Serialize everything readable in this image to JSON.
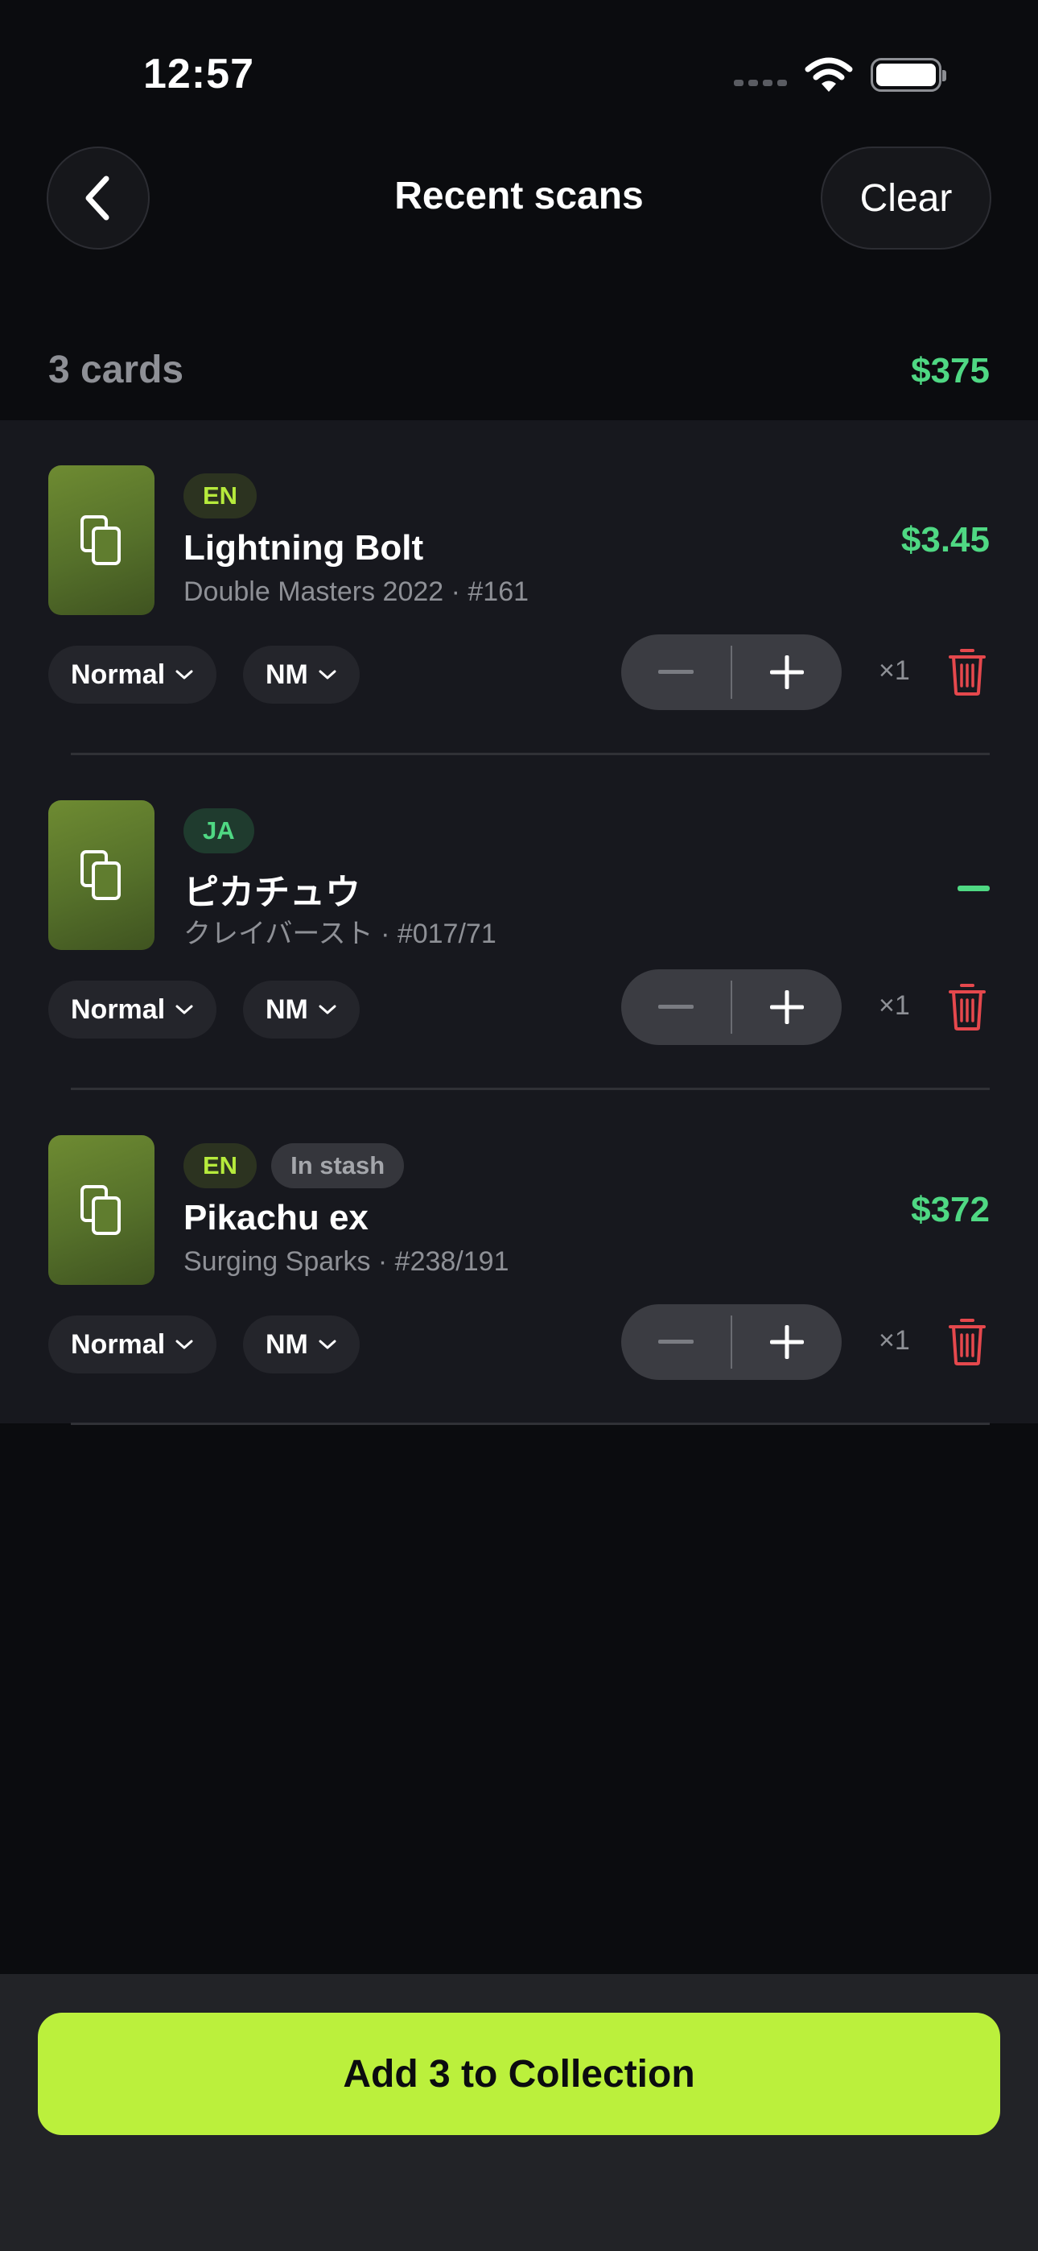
{
  "status_bar": {
    "time": "12:57"
  },
  "nav": {
    "title": "Recent scans",
    "clear_label": "Clear"
  },
  "summary": {
    "count_label": "3 cards",
    "total_value": "$375"
  },
  "cards": [
    {
      "language": "EN",
      "stash_label": "",
      "name": "Lightning Bolt",
      "set_line": "Double Masters 2022 · #161",
      "price": "$3.45",
      "finish": "Normal",
      "condition": "NM",
      "quantity": "×1"
    },
    {
      "language": "JA",
      "stash_label": "",
      "name": "ピカチュウ",
      "set_line": "クレイバースト · #017/71",
      "price": "",
      "finish": "Normal",
      "condition": "NM",
      "quantity": "×1"
    },
    {
      "language": "EN",
      "stash_label": "In stash",
      "name": "Pikachu ex",
      "set_line": "Surging Sparks · #238/191",
      "price": "$372",
      "finish": "Normal",
      "condition": "NM",
      "quantity": "×1"
    }
  ],
  "footer": {
    "add_label": "Add 3 to Collection"
  },
  "colors": {
    "accent": "#bbf03c",
    "price_green": "#4fd883",
    "delete_red": "#e5484d"
  },
  "icons": {
    "back": "chevron-left-icon",
    "card_thumb": "cards-stack-icon",
    "dropdown": "chevron-down-icon",
    "minus": "minus-icon",
    "plus": "plus-icon",
    "delete": "trash-icon"
  }
}
